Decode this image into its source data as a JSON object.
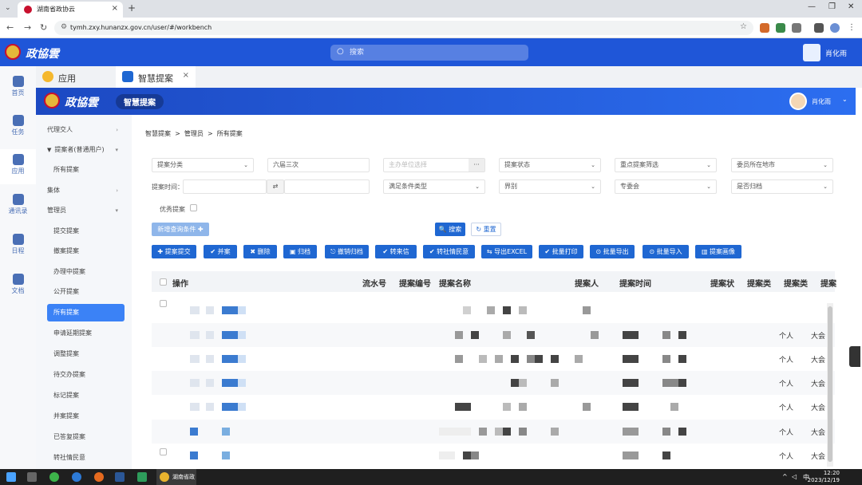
{
  "browser": {
    "tab_title": "湖南省政协云",
    "url": "tymh.zxy.hunanzx.gov.cn/user/#/workbench"
  },
  "app_header": {
    "logo_text": "政協雲",
    "search_placeholder": "搜索",
    "user_name": "肖化雨"
  },
  "rail": [
    {
      "label": "首页"
    },
    {
      "label": "任务"
    },
    {
      "label": "应用"
    },
    {
      "label": "通讯录"
    },
    {
      "label": "日程"
    },
    {
      "label": "文档"
    }
  ],
  "app_tabs": [
    {
      "label": "应用"
    },
    {
      "label": "智慧提案",
      "close": "×"
    }
  ],
  "banner": {
    "logo_text": "政協雲",
    "title": "智慧提案",
    "user_name": "肖化雨"
  },
  "sidebar": {
    "items": [
      {
        "label": "代理交人",
        "arrow": "›"
      },
      {
        "label": "提案者(普通用户)",
        "arrow": "▾",
        "prefix": "▼"
      },
      {
        "label": "所有提案"
      },
      {
        "label": "集体",
        "arrow": "›"
      },
      {
        "label": "管理员",
        "arrow": "▾"
      },
      {
        "label": "提交提案"
      },
      {
        "label": "撤案提案"
      },
      {
        "label": "办理中提案"
      },
      {
        "label": "公开提案"
      },
      {
        "label": "所有提案"
      },
      {
        "label": "申请延期提案"
      },
      {
        "label": "调整提案"
      },
      {
        "label": "待交办提案"
      },
      {
        "label": "标记提案"
      },
      {
        "label": "并案提案"
      },
      {
        "label": "已答复提案"
      },
      {
        "label": "转社情民意"
      }
    ]
  },
  "breadcrumb": [
    "智慧提案",
    "管理员",
    "所有提案"
  ],
  "breadcrumb_sep": ">",
  "filters": {
    "row1": [
      {
        "label": "提案分类",
        "chev": "⌄"
      },
      {
        "label": "六届三次"
      },
      {
        "label": "主办单位选择",
        "btn": "···"
      },
      {
        "label": "提案状态",
        "chev": "⌄"
      },
      {
        "label": "重点提案筛选",
        "chev": "⌄"
      },
      {
        "label": "委员所在地市",
        "chev": "⌄"
      }
    ],
    "time_label": "提案时间：",
    "swap": "⇄",
    "row2": [
      {
        "label": "满足条件类型",
        "chev": "⌄"
      },
      {
        "label": "界别",
        "chev": "⌄"
      },
      {
        "label": "专委会",
        "chev": "⌄"
      },
      {
        "label": "是否归档",
        "chev": "⌄"
      }
    ],
    "excellent_label": "优秀提案"
  },
  "buttons": {
    "add_condition": "新增查询条件 ✚",
    "search": "🔍 搜索",
    "reset": "↻ 重置",
    "toolbar": [
      "✚ 提案提交",
      "✔ 并案",
      "✖ 删除",
      "▣ 归档",
      "⎋ 撤销归档",
      "✔ 转来信",
      "✔ 转社情民意",
      "⇆ 导出EXCEL",
      "✔ 批量打印",
      "⊙ 批量导出",
      "⊙ 批量导入",
      "▥ 提案画像"
    ]
  },
  "table": {
    "columns": [
      "操作",
      "流水号",
      "提案编号",
      "提案名称",
      "提案人",
      "提案时间",
      "提案状",
      "提案类",
      "提案类",
      "提案"
    ],
    "rows": [
      {
        "type": "",
        "kind": ""
      },
      {
        "type": "个人",
        "kind": "大会"
      },
      {
        "type": "个人",
        "kind": "大会"
      },
      {
        "type": "个人",
        "kind": "大会"
      },
      {
        "type": "个人",
        "kind": "大会"
      },
      {
        "type": "个人",
        "kind": "大会"
      },
      {
        "type": "个人",
        "kind": "大会"
      }
    ]
  },
  "taskbar": {
    "chrome_label": "湖南省政",
    "time": "12:20",
    "date": "2023/12/19",
    "ime": "中"
  },
  "colors": {
    "primary": "#1f56d8",
    "button": "#1f67d2",
    "active_menu": "#3b82f6"
  }
}
